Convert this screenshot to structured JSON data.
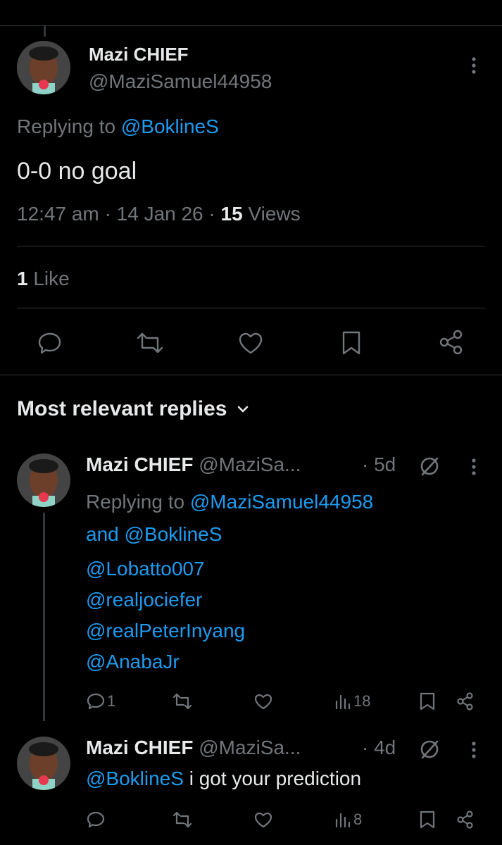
{
  "main_tweet": {
    "display_name": "Mazi CHIEF",
    "handle": "@MaziSamuel44958",
    "replying_prefix": "Replying to ",
    "replying_to": "@BoklineS",
    "text": "0-0 no goal",
    "time": "12:47 am",
    "date": "14 Jan 26",
    "views_count": "15",
    "views_label": "Views",
    "likes_count": "1",
    "likes_label": "Like"
  },
  "replies_header": {
    "label": "Most relevant replies"
  },
  "replies": [
    {
      "display_name": "Mazi CHIEF",
      "handle": "@MaziSa...",
      "age": "· 5d",
      "replying_prefix": "Replying to ",
      "replying_to_1": "@MaziSamuel44958",
      "replying_and": "and ",
      "replying_to_2": "@BoklineS",
      "mentions": [
        "@Lobatto007",
        "@realjociefer",
        "@realPeterInyang",
        "@AnabaJr"
      ],
      "reply_count": "1",
      "views": "18"
    },
    {
      "display_name": "Mazi CHIEF",
      "handle": "@MaziSa...",
      "age": "· 4d",
      "mention": "@BoklineS",
      "text": " i got your prediction",
      "views": "8"
    }
  ],
  "colors": {
    "background": "#000000",
    "text": "#e7e9ea",
    "muted": "#71767b",
    "link": "#1d9bf0",
    "divider": "#2f3336"
  }
}
